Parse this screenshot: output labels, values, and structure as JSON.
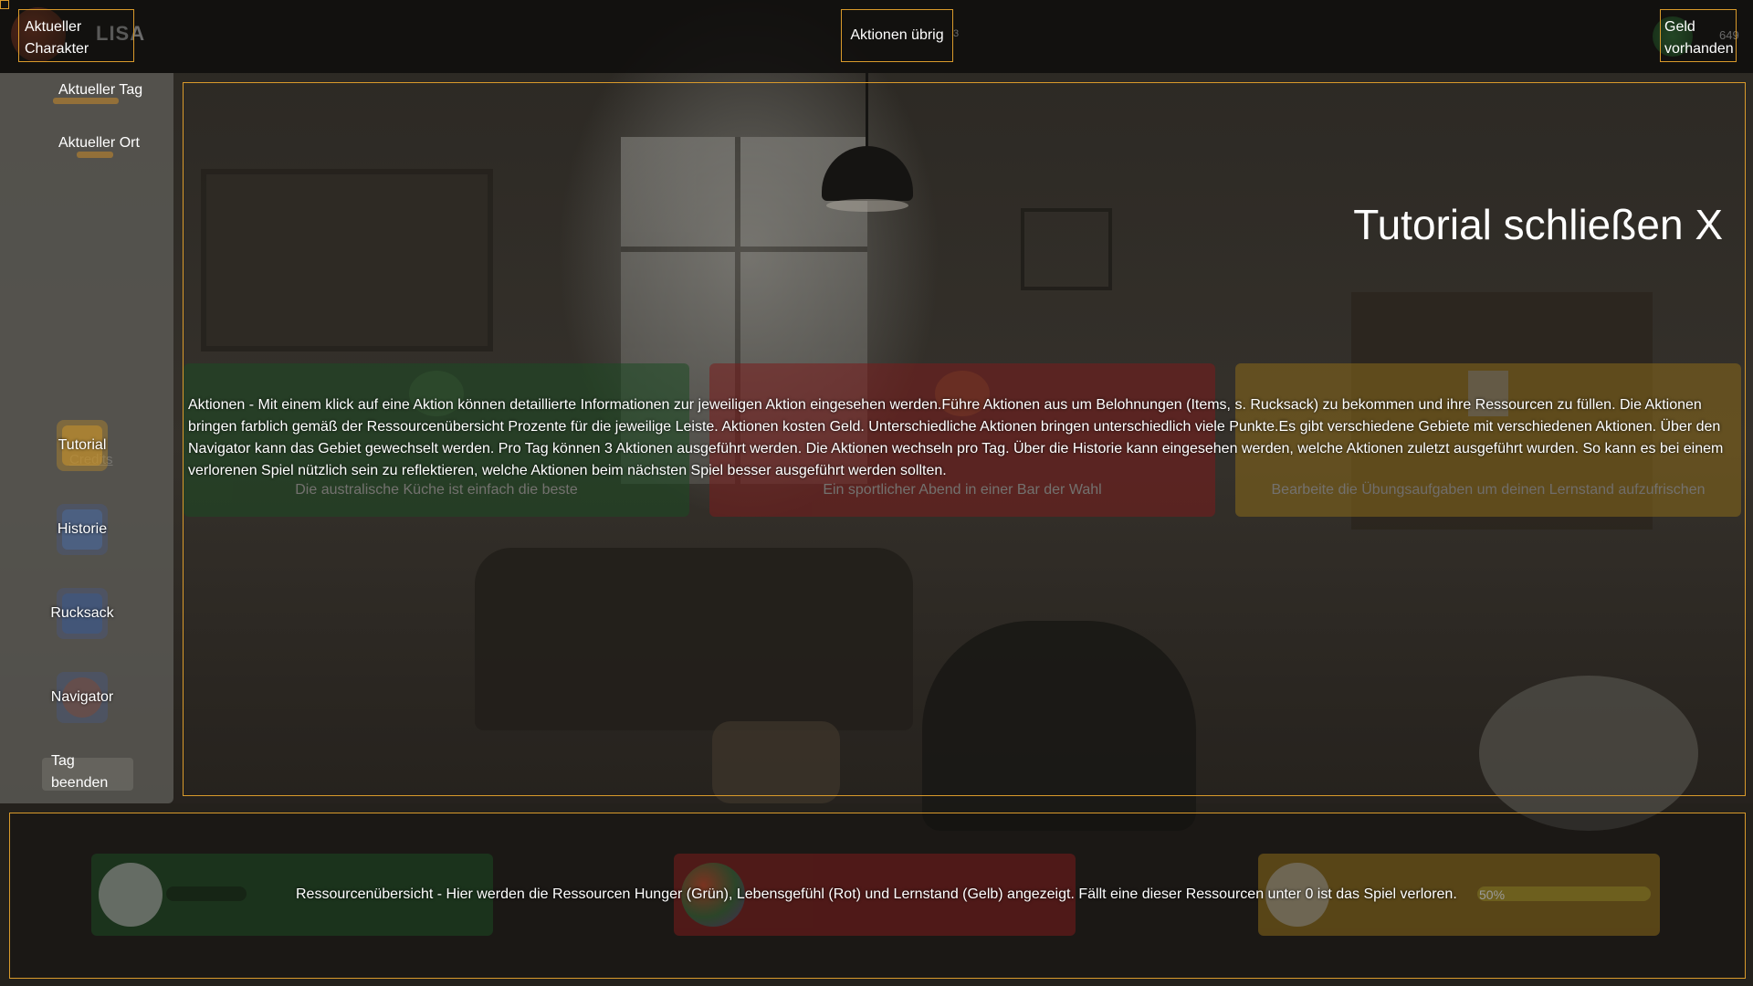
{
  "topbar": {
    "character_label": "Aktueller Charakter",
    "character_name": "LISA",
    "actions_label": "Aktionen übrig",
    "money_label": "Geld vorhanden",
    "money_value": "649"
  },
  "sidebar": {
    "day_label": "Aktueller Tag",
    "location_label": "Aktueller Ort",
    "credits_label": "Credits",
    "nav": [
      {
        "label": "Tutorial",
        "icon": "tutorial-icon"
      },
      {
        "label": "Historie",
        "icon": "history-icon"
      },
      {
        "label": "Rucksack",
        "icon": "backpack-icon"
      },
      {
        "label": "Navigator",
        "icon": "compass-icon"
      }
    ],
    "end_day_label": "Tag beenden"
  },
  "main": {
    "tutorial_close": "Tutorial schließen X",
    "action_cards": [
      {
        "subtitle": "Die australische Küche ist einfach die beste",
        "icon": "food-icon"
      },
      {
        "subtitle": "Ein sportlicher Abend in einer Bar der Wahl",
        "icon": "sports-icon"
      },
      {
        "subtitle": "Bearbeite die Übungsaufgaben um deinen Lernstand aufzufrischen",
        "icon": "document-icon"
      }
    ],
    "actions_tutorial": "Aktionen - Mit einem klick auf eine Aktion können detaillierte Informationen zur jeweiligen Aktion eingesehen werden.Führe Aktionen aus um Belohnungen (Items, s. Rucksack) zu bekommen und ihre Ressourcen zu füllen. Die Aktionen bringen farblich gemäß der Ressourcenübersicht Prozente für die jeweilige Leiste. Aktionen kosten Geld. Unterschiedliche Aktionen bringen unterschiedlich viele Punkte.Es gibt verschiedene Gebiete mit verschiedenen Aktionen. Über den Navigator kann das Gebiet gewechselt werden. Pro Tag können 3 Aktionen ausgeführt werden. Die Aktionen wechseln pro Tag. Über die Historie kann eingesehen werden, welche Aktionen zuletzt ausgeführt wurden. So kann es bei einem verlorenen Spiel nützlich sein zu reflektieren, welche Aktionen beim nächsten Spiel besser ausgeführt werden sollten."
  },
  "resources": {
    "tutorial": "Ressourcenübersicht - Hier werden die Ressourcen Hunger (Grün), Lebensgefühl (Rot) und Lernstand (Gelb) angezeigt. Fällt eine dieser Ressourcen unter 0 ist das Spiel verloren.",
    "learning_value": "50%",
    "items": [
      {
        "icon": "food-bowl-icon",
        "color": "#1c4a23"
      },
      {
        "icon": "life-icon",
        "color": "#7a1c1c"
      },
      {
        "icon": "student-icon",
        "color": "#8a6a1a"
      }
    ]
  },
  "colors": {
    "accent": "#d99a2b"
  }
}
